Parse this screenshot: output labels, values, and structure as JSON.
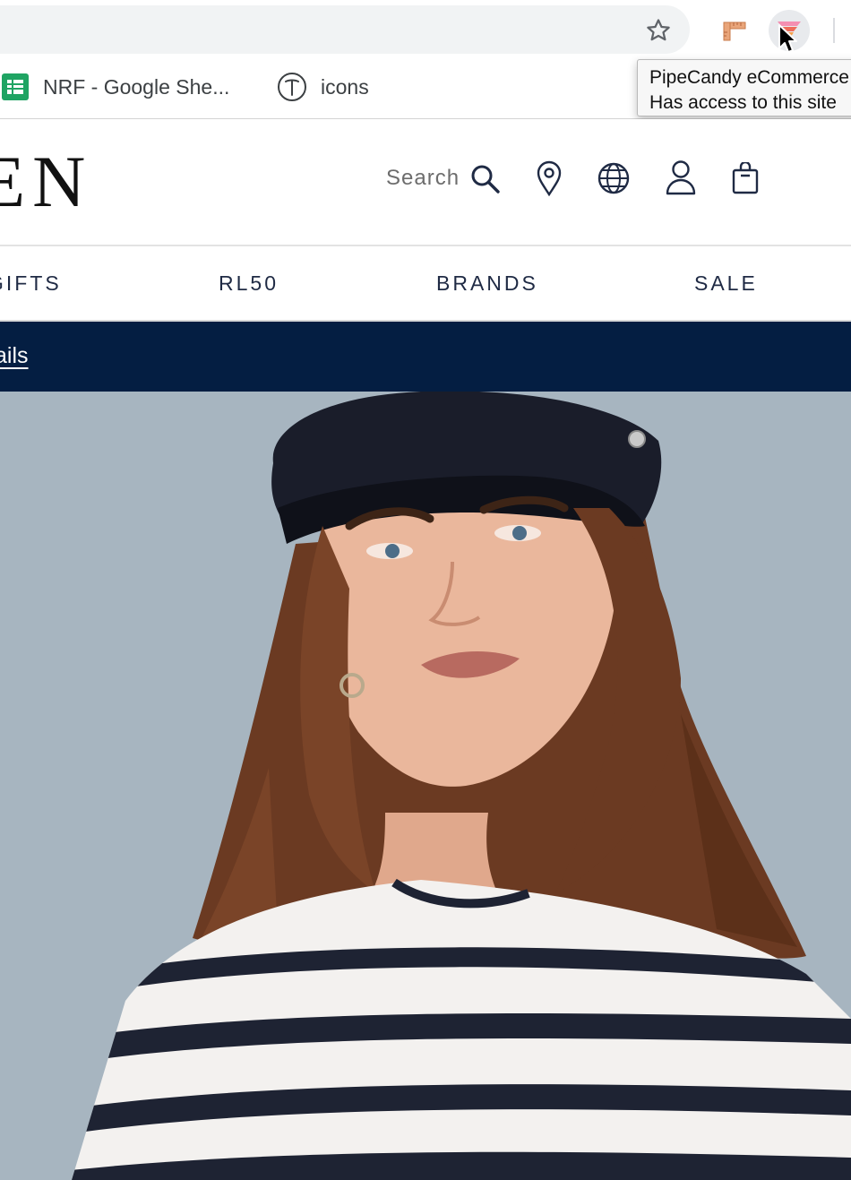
{
  "browser": {
    "bookmarks": [
      {
        "label": "NRF - Google She...",
        "icon": "google-sheets-icon"
      },
      {
        "label": "icons",
        "icon": "circle-t-icon"
      }
    ],
    "extension_tooltip": {
      "line1": "PipeCandy eCommerce",
      "line2": "Has access to this site"
    }
  },
  "site": {
    "logo_text": "EN",
    "search_label": "Search",
    "nav": [
      "GIFTS",
      "RL50",
      "BRANDS",
      "SALE"
    ],
    "promo_link": "ails",
    "colors": {
      "navy": "#041e42",
      "nav_text": "#1f2a44",
      "hero_background": "#a7b5c0"
    }
  }
}
